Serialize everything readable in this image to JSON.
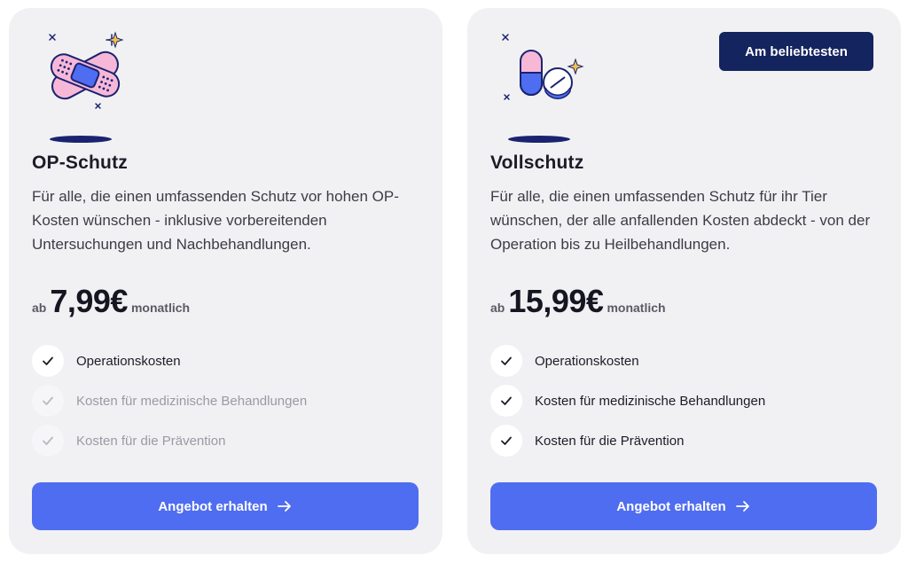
{
  "plans": [
    {
      "title": "OP-Schutz",
      "description": "Für alle, die einen umfassenden Schutz vor hohen OP-Kosten wünschen - inklusive vorbereitenden Untersuchungen und Nachbehandlungen.",
      "price_prefix": "ab",
      "price": "7,99€",
      "price_suffix": "monatlich",
      "features": [
        {
          "label": "Operationskosten",
          "included": true
        },
        {
          "label": "Kosten für medizinische Behandlungen",
          "included": false
        },
        {
          "label": "Kosten für die Prävention",
          "included": false
        }
      ],
      "cta_label": "Angebot erhalten",
      "illustration": "bandage-icon"
    },
    {
      "title": "Vollschutz",
      "badge": "Am beliebtesten",
      "description": "Für alle, die einen umfassenden Schutz für ihr Tier wünschen, der alle anfallenden Kosten abdeckt - von der Operation bis zu Heilbehandlungen.",
      "price_prefix": "ab",
      "price": "15,99€",
      "price_suffix": "monatlich",
      "features": [
        {
          "label": "Operationskosten",
          "included": true
        },
        {
          "label": "Kosten für medizinische Behandlungen",
          "included": true
        },
        {
          "label": "Kosten für die Prävention",
          "included": true
        }
      ],
      "cta_label": "Angebot erhalten",
      "illustration": "pills-icon"
    }
  ],
  "colors": {
    "card_bg": "#f1f1f3",
    "accent": "#4f6df0",
    "badge_bg": "#14245e"
  }
}
